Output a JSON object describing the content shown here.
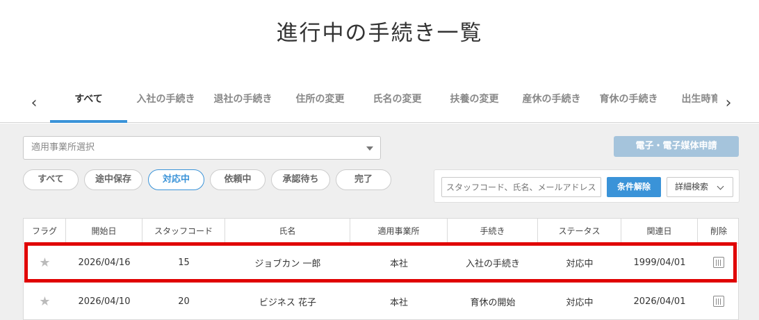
{
  "page": {
    "title": "進行中の手続き一覧"
  },
  "tabs": [
    {
      "label": "すべて",
      "active": true
    },
    {
      "label": "入社の手続き",
      "active": false
    },
    {
      "label": "退社の手続き",
      "active": false
    },
    {
      "label": "住所の変更",
      "active": false
    },
    {
      "label": "氏名の変更",
      "active": false
    },
    {
      "label": "扶養の変更",
      "active": false
    },
    {
      "label": "産休の手続き",
      "active": false
    },
    {
      "label": "育休の手続き",
      "active": false
    },
    {
      "label": "出生時育休",
      "active": false
    }
  ],
  "office_select": {
    "placeholder": "適用事業所選択"
  },
  "apply_button": {
    "label": "電子・電子媒体申請"
  },
  "status_filters": [
    {
      "label": "すべて",
      "active": false
    },
    {
      "label": "途中保存",
      "active": false
    },
    {
      "label": "対応中",
      "active": true
    },
    {
      "label": "依頼中",
      "active": false
    },
    {
      "label": "承認待ち",
      "active": false
    },
    {
      "label": "完了",
      "active": false
    }
  ],
  "search": {
    "placeholder": "スタッフコード、氏名、メールアドレス",
    "clear_label": "条件解除",
    "detail_label": "詳細検索"
  },
  "table": {
    "columns": [
      "フラグ",
      "開始日",
      "スタッフコード",
      "氏名",
      "適用事業所",
      "手続き",
      "ステータス",
      "関連日",
      "削除"
    ],
    "rows": [
      {
        "start": "2026/04/16",
        "code": "15",
        "name": "ジョブカン 一郎",
        "office": "本社",
        "procedure": "入社の手続き",
        "status": "対応中",
        "related": "1999/04/01"
      },
      {
        "start": "2026/04/10",
        "code": "20",
        "name": "ビジネス 花子",
        "office": "本社",
        "procedure": "育休の開始",
        "status": "対応中",
        "related": "2026/04/01"
      }
    ]
  },
  "colors": {
    "accent": "#3a93d8",
    "highlight": "#e00000",
    "apply_button": "#a5c4dc"
  }
}
